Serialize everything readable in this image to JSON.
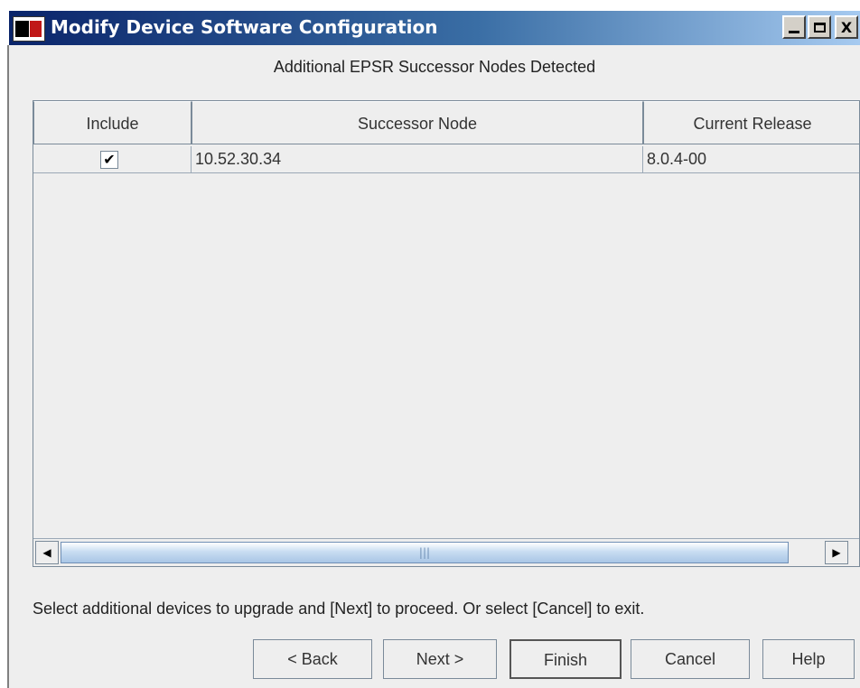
{
  "window": {
    "title": "Modify Device Software Configuration",
    "controls": {
      "minimize": "_",
      "maximize": "□",
      "close": "X"
    }
  },
  "heading": "Additional EPSR Successor Nodes Detected",
  "table": {
    "columns": [
      "Include",
      "Successor Node",
      "Current Release"
    ],
    "rows": [
      {
        "include": true,
        "include_mark": "✔",
        "successor_node": "10.52.30.34",
        "current_release": "8.0.4-00"
      }
    ]
  },
  "scrollbar": {
    "left_arrow": "◀",
    "right_arrow": "▶",
    "grip": "|||"
  },
  "footer_message": "Select additional devices to upgrade and [Next] to proceed. Or select [Cancel] to exit.",
  "buttons": {
    "back": "< Back",
    "next": "Next >",
    "finish": "Finish",
    "cancel": "Cancel",
    "help": "Help"
  }
}
